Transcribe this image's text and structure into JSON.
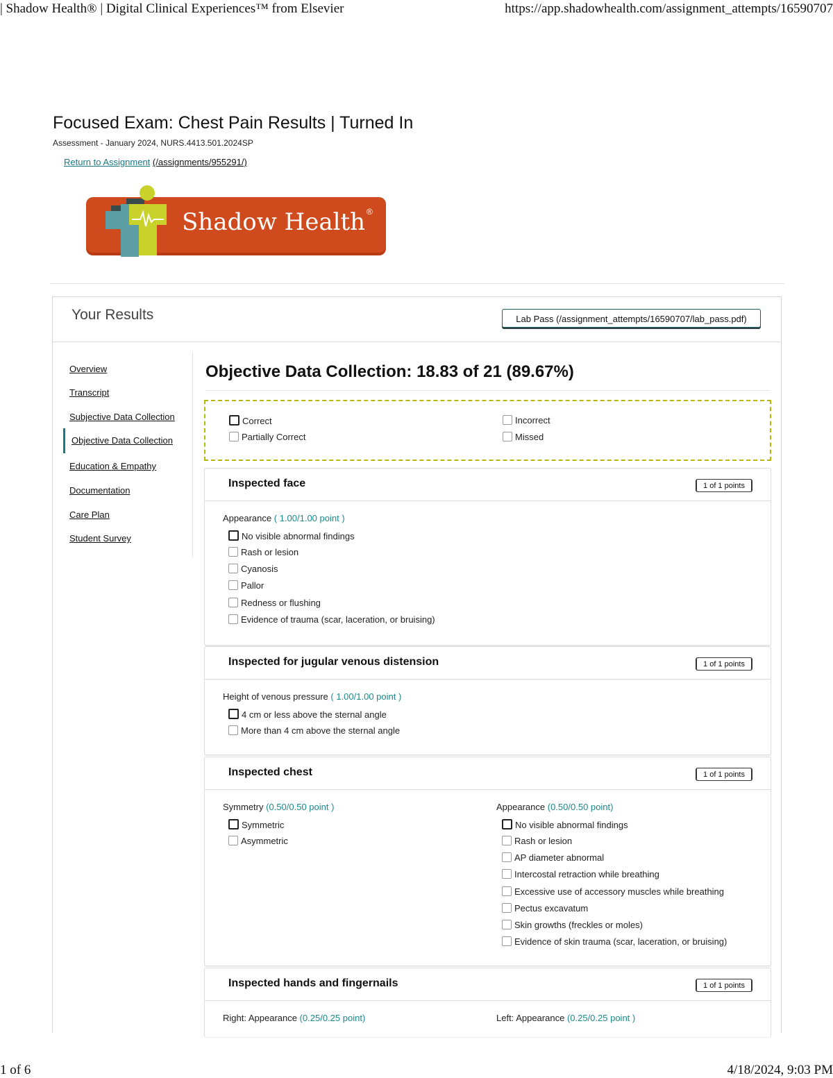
{
  "print_header": {
    "left": "| Shadow Health® | Digital Clinical Experiences™ from Elsevier",
    "right": "https://app.shadowhealth.com/assignment_attempts/16590707"
  },
  "print_footer": {
    "page": "1 of 6",
    "datetime": "4/18/2024, 9:03 PM"
  },
  "page": {
    "title": "Focused Exam: Chest Pain Results | Turned In",
    "subtitle": "Assessment - January 2024, NURS.4413.501.2024SP",
    "return_link": "Return to Assignment",
    "return_path": "(/assignments/955291/)"
  },
  "logo": {
    "text": "Shadow Health",
    "mark": "®"
  },
  "results": {
    "heading": "Your Results",
    "lab_pass": "Lab Pass (/assignment_attempts/16590707/lab_pass.pdf)"
  },
  "nav": [
    {
      "label": "Overview"
    },
    {
      "label": "Transcript"
    },
    {
      "label": "Subjective Data Collection"
    },
    {
      "label": "Objective Data Collection"
    },
    {
      "label": "Education & Empathy"
    },
    {
      "label": "Documentation"
    },
    {
      "label": "Care Plan"
    },
    {
      "label": "Student Survey"
    }
  ],
  "main": {
    "title": "Objective Data Collection: 18.83 of 21 (89.67%)",
    "legend": [
      "Correct",
      "Incorrect",
      "Partially Correct",
      "Missed"
    ],
    "sections": [
      {
        "title": "Inspected face",
        "points": "1 of 1 points",
        "questions": [
          {
            "label": "Appearance",
            "score": "( 1.00/1.00 point )",
            "options": [
              "No visible abnormal findings",
              "Rash or lesion",
              "Cyanosis",
              "Pallor",
              "Redness or flushing",
              "Evidence of trauma (scar, laceration, or bruising)"
            ]
          }
        ]
      },
      {
        "title": "Inspected for jugular venous distension",
        "points": "1 of 1 points",
        "questions": [
          {
            "label": "Height of venous pressure",
            "score": "( 1.00/1.00 point )",
            "options": [
              "4 cm or less above the sternal angle",
              "More than 4 cm above the sternal angle"
            ]
          }
        ]
      },
      {
        "title": "Inspected chest",
        "points": "1 of 1 points",
        "questions": [
          {
            "label": "Symmetry",
            "score": "(0.50/0.50 point )",
            "options": [
              "Symmetric",
              "Asymmetric"
            ]
          },
          {
            "label": "Appearance",
            "score": "(0.50/0.50 point)",
            "options": [
              "No visible abnormal findings",
              "Rash or lesion",
              "AP diameter abnormal",
              "Intercostal retraction while breathing",
              "Excessive use of accessory muscles while breathing",
              "Pectus excavatum",
              "Skin growths (freckles or moles)",
              "Evidence of skin trauma (scar, laceration, or bruising)"
            ]
          }
        ]
      },
      {
        "title": "Inspected hands and fingernails",
        "points": "1 of 1 points",
        "questions": [
          {
            "label": "Right: Appearance",
            "score": "(0.25/0.25 point)"
          },
          {
            "label": "Left: Appearance",
            "score": "(0.25/0.25 point )"
          }
        ]
      }
    ]
  },
  "colors": {
    "brand_orange": "#cf4a1c",
    "teal": "#1a7a80",
    "lime": "#b8c21a",
    "legend_border": "#b8b800"
  }
}
